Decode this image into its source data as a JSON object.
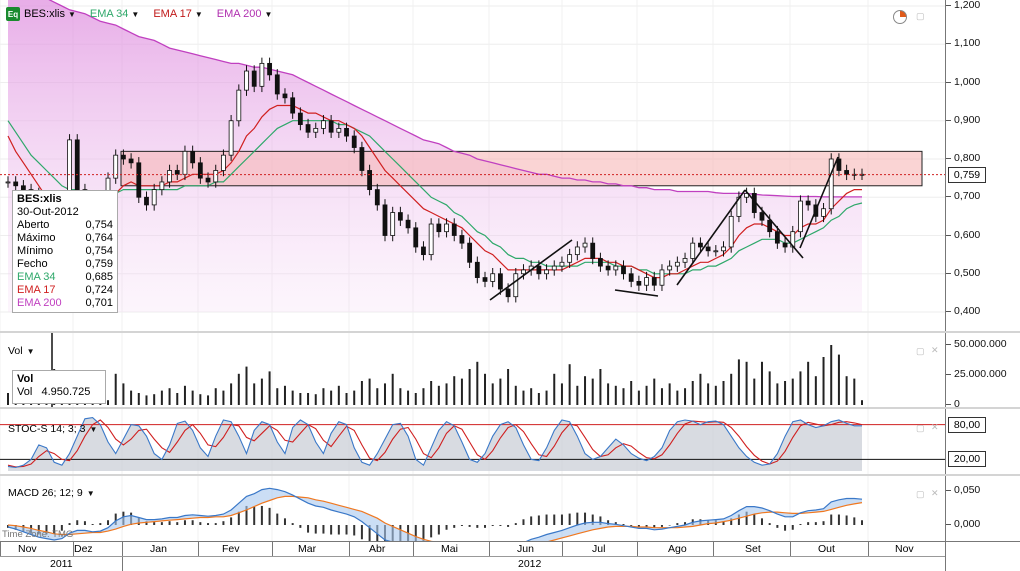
{
  "toolbar": {
    "eq_icon": "Eq",
    "symbol": "BES:xlis",
    "ema34": "EMA 34",
    "ema17": "EMA 17",
    "ema200": "EMA 200"
  },
  "colors": {
    "ema34": "#2ea86a",
    "ema17": "#d02020",
    "ema200": "#c040c0",
    "stoch_k": "#3a78c8",
    "stoch_d": "#d02020",
    "macd": "#3a78c8",
    "signal": "#f07820"
  },
  "info_box": {
    "title": "BES:xlis",
    "date": "30-Out-2012",
    "rows": [
      {
        "label": "Aberto",
        "value": "0,754"
      },
      {
        "label": "Máximo",
        "value": "0,764"
      },
      {
        "label": "Mínimo",
        "value": "0,754"
      },
      {
        "label": "Fecho",
        "value": "0,759"
      },
      {
        "label": "EMA 34",
        "value": "0,685"
      },
      {
        "label": "EMA 17",
        "value": "0,724"
      },
      {
        "label": "EMA 200",
        "value": "0,701"
      }
    ]
  },
  "price_axis": {
    "ticks": [
      "1,200",
      "1,100",
      "1,000",
      "0,900",
      "0,800",
      "0,700",
      "0,600",
      "0,500",
      "0,400"
    ],
    "current": "0,759"
  },
  "volume": {
    "label": "Vol",
    "box_title": "Vol",
    "box_label": "Vol",
    "box_value": "4.950.725",
    "ticks": [
      "50.000.000",
      "25.000.000",
      "0"
    ]
  },
  "stoch": {
    "label": "STOC-S 14; 3; 3",
    "ticks": [
      "80,00",
      "20,00"
    ]
  },
  "macd": {
    "label": "MACD 26; 12; 9",
    "ticks": [
      "0,050",
      "0,000"
    ]
  },
  "timezone": "Time Zone: TMG",
  "x_axis": {
    "months": [
      "Nov",
      "Dez",
      "Jan",
      "Fev",
      "Mar",
      "Abr",
      "Mai",
      "Jun",
      "Jul",
      "Ago",
      "Set",
      "Out",
      "Nov"
    ],
    "years": [
      "2011",
      "2012"
    ]
  },
  "chart_data": {
    "type": "line",
    "title": "BES:xlis",
    "x_months": [
      "Nov",
      "Dez",
      "Jan",
      "Fev",
      "Mar",
      "Abr",
      "Mai",
      "Jun",
      "Jul",
      "Ago",
      "Set",
      "Out",
      "Nov"
    ],
    "close": [
      0.74,
      0.73,
      0.72,
      0.71,
      0.68,
      0.65,
      0.63,
      0.61,
      0.85,
      0.72,
      0.7,
      0.62,
      0.64,
      0.75,
      0.81,
      0.8,
      0.79,
      0.7,
      0.68,
      0.72,
      0.74,
      0.77,
      0.76,
      0.82,
      0.79,
      0.75,
      0.74,
      0.77,
      0.81,
      0.9,
      0.98,
      1.03,
      0.99,
      1.05,
      1.02,
      0.97,
      0.96,
      0.92,
      0.89,
      0.87,
      0.88,
      0.9,
      0.87,
      0.88,
      0.86,
      0.83,
      0.77,
      0.72,
      0.68,
      0.6,
      0.66,
      0.64,
      0.62,
      0.57,
      0.55,
      0.63,
      0.61,
      0.63,
      0.6,
      0.58,
      0.53,
      0.49,
      0.48,
      0.5,
      0.46,
      0.44,
      0.5,
      0.51,
      0.52,
      0.5,
      0.51,
      0.52,
      0.53,
      0.55,
      0.57,
      0.58,
      0.54,
      0.52,
      0.51,
      0.52,
      0.5,
      0.48,
      0.47,
      0.49,
      0.47,
      0.51,
      0.52,
      0.53,
      0.54,
      0.58,
      0.57,
      0.56,
      0.56,
      0.57,
      0.65,
      0.7,
      0.71,
      0.66,
      0.64,
      0.61,
      0.58,
      0.57,
      0.61,
      0.69,
      0.68,
      0.65,
      0.67,
      0.8,
      0.77,
      0.76,
      0.76,
      0.76
    ],
    "ema17": [
      0.86,
      0.82,
      0.79,
      0.76,
      0.73,
      0.7,
      0.68,
      0.66,
      0.68,
      0.69,
      0.69,
      0.68,
      0.68,
      0.69,
      0.71,
      0.73,
      0.74,
      0.73,
      0.73,
      0.73,
      0.73,
      0.74,
      0.74,
      0.75,
      0.76,
      0.76,
      0.76,
      0.76,
      0.77,
      0.79,
      0.82,
      0.86,
      0.88,
      0.91,
      0.93,
      0.94,
      0.94,
      0.94,
      0.93,
      0.92,
      0.92,
      0.91,
      0.9,
      0.9,
      0.89,
      0.88,
      0.86,
      0.83,
      0.8,
      0.77,
      0.75,
      0.73,
      0.71,
      0.69,
      0.67,
      0.66,
      0.65,
      0.64,
      0.63,
      0.62,
      0.6,
      0.58,
      0.56,
      0.55,
      0.53,
      0.51,
      0.51,
      0.51,
      0.51,
      0.51,
      0.51,
      0.51,
      0.51,
      0.52,
      0.53,
      0.54,
      0.54,
      0.54,
      0.53,
      0.53,
      0.52,
      0.52,
      0.51,
      0.5,
      0.49,
      0.49,
      0.5,
      0.5,
      0.51,
      0.52,
      0.53,
      0.53,
      0.54,
      0.55,
      0.57,
      0.6,
      0.62,
      0.63,
      0.63,
      0.62,
      0.61,
      0.6,
      0.6,
      0.62,
      0.63,
      0.63,
      0.64,
      0.67,
      0.69,
      0.71,
      0.72,
      0.72
    ],
    "ema34": [
      0.9,
      0.87,
      0.84,
      0.81,
      0.79,
      0.77,
      0.75,
      0.73,
      0.72,
      0.72,
      0.71,
      0.7,
      0.7,
      0.7,
      0.71,
      0.72,
      0.72,
      0.72,
      0.72,
      0.72,
      0.72,
      0.72,
      0.72,
      0.73,
      0.73,
      0.73,
      0.73,
      0.74,
      0.74,
      0.76,
      0.78,
      0.8,
      0.82,
      0.84,
      0.86,
      0.88,
      0.89,
      0.9,
      0.9,
      0.9,
      0.9,
      0.9,
      0.9,
      0.89,
      0.89,
      0.88,
      0.87,
      0.86,
      0.84,
      0.82,
      0.8,
      0.78,
      0.76,
      0.74,
      0.72,
      0.7,
      0.69,
      0.68,
      0.66,
      0.65,
      0.63,
      0.61,
      0.6,
      0.58,
      0.57,
      0.55,
      0.54,
      0.54,
      0.53,
      0.53,
      0.52,
      0.52,
      0.52,
      0.52,
      0.52,
      0.53,
      0.53,
      0.53,
      0.53,
      0.52,
      0.52,
      0.52,
      0.51,
      0.51,
      0.5,
      0.5,
      0.5,
      0.5,
      0.5,
      0.51,
      0.51,
      0.52,
      0.52,
      0.53,
      0.54,
      0.56,
      0.57,
      0.58,
      0.59,
      0.59,
      0.59,
      0.58,
      0.58,
      0.59,
      0.6,
      0.61,
      0.62,
      0.64,
      0.65,
      0.67,
      0.68,
      0.685
    ],
    "ema200": [
      1.27,
      1.26,
      1.25,
      1.24,
      1.23,
      1.22,
      1.21,
      1.2,
      1.19,
      1.185,
      1.18,
      1.17,
      1.16,
      1.155,
      1.15,
      1.14,
      1.13,
      1.12,
      1.115,
      1.11,
      1.1,
      1.09,
      1.085,
      1.08,
      1.075,
      1.07,
      1.065,
      1.06,
      1.055,
      1.05,
      1.05,
      1.045,
      1.04,
      1.04,
      1.035,
      1.03,
      1.025,
      1.02,
      1.01,
      1.0,
      0.99,
      0.98,
      0.97,
      0.96,
      0.95,
      0.94,
      0.93,
      0.92,
      0.91,
      0.9,
      0.89,
      0.88,
      0.87,
      0.86,
      0.85,
      0.845,
      0.84,
      0.83,
      0.82,
      0.815,
      0.81,
      0.8,
      0.795,
      0.79,
      0.785,
      0.78,
      0.775,
      0.77,
      0.765,
      0.76,
      0.76,
      0.755,
      0.75,
      0.75,
      0.745,
      0.745,
      0.74,
      0.74,
      0.735,
      0.735,
      0.73,
      0.73,
      0.725,
      0.725,
      0.72,
      0.72,
      0.72,
      0.715,
      0.715,
      0.715,
      0.715,
      0.715,
      0.712,
      0.71,
      0.71,
      0.71,
      0.71,
      0.708,
      0.706,
      0.705,
      0.704,
      0.703,
      0.702,
      0.702,
      0.702,
      0.702,
      0.701,
      0.701,
      0.701,
      0.701,
      0.701,
      0.701
    ],
    "volume": [
      10,
      6,
      8,
      4,
      5,
      18,
      30,
      12,
      14,
      22,
      9,
      8,
      6,
      4,
      26,
      18,
      12,
      10,
      8,
      9,
      12,
      14,
      10,
      16,
      12,
      9,
      8,
      14,
      12,
      18,
      26,
      32,
      18,
      22,
      28,
      14,
      16,
      12,
      10,
      10,
      9,
      14,
      12,
      16,
      10,
      12,
      20,
      22,
      14,
      18,
      26,
      14,
      12,
      10,
      14,
      20,
      16,
      18,
      24,
      22,
      30,
      36,
      26,
      18,
      22,
      30,
      16,
      12,
      14,
      10,
      12,
      26,
      18,
      34,
      16,
      24,
      22,
      30,
      18,
      16,
      14,
      20,
      12,
      16,
      22,
      14,
      18,
      12,
      14,
      20,
      26,
      18,
      16,
      20,
      26,
      38,
      36,
      22,
      36,
      28,
      18,
      20,
      22,
      28,
      36,
      24,
      40,
      50,
      42,
      24,
      22,
      4
    ],
    "stoch_k": [
      8,
      6,
      10,
      20,
      45,
      40,
      15,
      10,
      30,
      60,
      90,
      92,
      80,
      50,
      30,
      55,
      80,
      78,
      60,
      30,
      20,
      45,
      82,
      86,
      70,
      40,
      25,
      60,
      88,
      85,
      60,
      30,
      70,
      85,
      80,
      50,
      30,
      75,
      88,
      80,
      50,
      30,
      65,
      85,
      80,
      40,
      15,
      10,
      30,
      55,
      80,
      82,
      60,
      20,
      10,
      40,
      70,
      85,
      78,
      50,
      20,
      15,
      30,
      60,
      80,
      85,
      75,
      45,
      20,
      18,
      40,
      70,
      88,
      85,
      60,
      30,
      20,
      25,
      40,
      55,
      45,
      30,
      22,
      18,
      25,
      40,
      70,
      85,
      88,
      86,
      80,
      85,
      86,
      80,
      60,
      40,
      25,
      15,
      10,
      12,
      30,
      60,
      85,
      88,
      80,
      75,
      78,
      85,
      88,
      82,
      78,
      78
    ],
    "stoch_d": [
      10,
      7,
      8,
      12,
      25,
      35,
      30,
      20,
      18,
      35,
      60,
      80,
      88,
      75,
      55,
      45,
      55,
      70,
      72,
      55,
      40,
      32,
      50,
      70,
      80,
      65,
      45,
      42,
      58,
      80,
      78,
      58,
      52,
      65,
      78,
      70,
      53,
      50,
      65,
      80,
      73,
      53,
      42,
      60,
      77,
      70,
      45,
      22,
      18,
      32,
      55,
      72,
      75,
      55,
      30,
      23,
      40,
      65,
      78,
      72,
      50,
      28,
      20,
      35,
      57,
      75,
      80,
      68,
      47,
      28,
      25,
      43,
      66,
      81,
      78,
      58,
      37,
      25,
      28,
      40,
      47,
      43,
      32,
      23,
      21,
      28,
      45,
      65,
      81,
      86,
      85,
      84,
      85,
      84,
      75,
      60,
      42,
      27,
      17,
      12,
      17,
      34,
      58,
      78,
      84,
      81,
      78,
      80,
      84,
      85,
      83,
      80
    ],
    "macd": [
      -0.003,
      -0.006,
      -0.01,
      -0.014,
      -0.018,
      -0.02,
      -0.022,
      -0.02,
      -0.012,
      -0.008,
      -0.008,
      -0.01,
      -0.009,
      -0.004,
      0.006,
      0.012,
      0.014,
      0.011,
      0.008,
      0.008,
      0.009,
      0.011,
      0.011,
      0.014,
      0.015,
      0.014,
      0.013,
      0.014,
      0.016,
      0.022,
      0.032,
      0.042,
      0.046,
      0.052,
      0.054,
      0.052,
      0.049,
      0.044,
      0.038,
      0.032,
      0.028,
      0.026,
      0.022,
      0.019,
      0.016,
      0.012,
      0.005,
      -0.004,
      -0.013,
      -0.022,
      -0.025,
      -0.028,
      -0.032,
      -0.036,
      -0.039,
      -0.037,
      -0.036,
      -0.033,
      -0.032,
      -0.031,
      -0.032,
      -0.034,
      -0.035,
      -0.033,
      -0.034,
      -0.035,
      -0.031,
      -0.026,
      -0.021,
      -0.018,
      -0.014,
      -0.011,
      -0.008,
      -0.004,
      0.0,
      0.003,
      0.004,
      0.004,
      0.002,
      0.001,
      -0.001,
      -0.003,
      -0.005,
      -0.005,
      -0.007,
      -0.006,
      -0.004,
      -0.002,
      0.0,
      0.004,
      0.006,
      0.007,
      0.008,
      0.009,
      0.014,
      0.021,
      0.027,
      0.027,
      0.025,
      0.021,
      0.016,
      0.012,
      0.012,
      0.018,
      0.021,
      0.022,
      0.024,
      0.034,
      0.037,
      0.039,
      0.039,
      0.038
    ],
    "signal": [
      0.0,
      -0.001,
      -0.003,
      -0.005,
      -0.008,
      -0.01,
      -0.013,
      -0.014,
      -0.014,
      -0.013,
      -0.012,
      -0.011,
      -0.011,
      -0.009,
      -0.006,
      -0.002,
      0.001,
      0.003,
      0.004,
      0.005,
      0.006,
      0.007,
      0.008,
      0.009,
      0.01,
      0.011,
      0.011,
      0.012,
      0.012,
      0.014,
      0.018,
      0.022,
      0.027,
      0.032,
      0.036,
      0.04,
      0.042,
      0.042,
      0.041,
      0.04,
      0.037,
      0.035,
      0.032,
      0.029,
      0.026,
      0.023,
      0.02,
      0.015,
      0.01,
      0.003,
      -0.002,
      -0.007,
      -0.012,
      -0.017,
      -0.021,
      -0.024,
      -0.026,
      -0.028,
      -0.029,
      -0.03,
      -0.03,
      -0.031,
      -0.032,
      -0.032,
      -0.033,
      -0.033,
      -0.033,
      -0.032,
      -0.03,
      -0.028,
      -0.025,
      -0.022,
      -0.019,
      -0.016,
      -0.013,
      -0.01,
      -0.007,
      -0.005,
      -0.003,
      -0.002,
      -0.002,
      -0.002,
      -0.003,
      -0.003,
      -0.004,
      -0.004,
      -0.004,
      -0.004,
      -0.003,
      -0.002,
      0.0,
      0.002,
      0.003,
      0.005,
      0.007,
      0.01,
      0.013,
      0.016,
      0.018,
      0.019,
      0.019,
      0.018,
      0.017,
      0.017,
      0.018,
      0.019,
      0.02,
      0.023,
      0.026,
      0.029,
      0.031,
      0.033
    ],
    "price_ylim": [
      0.35,
      1.2
    ],
    "volume_ylim": [
      0,
      55000000
    ],
    "stoch_ylim": [
      0,
      100
    ],
    "macd_ylim": [
      -0.045,
      0.06
    ]
  }
}
